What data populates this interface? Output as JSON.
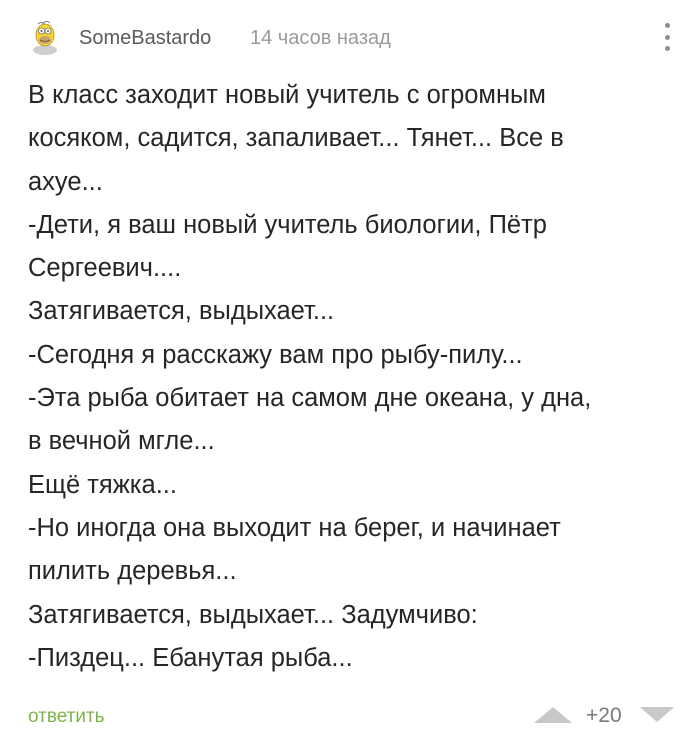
{
  "comment": {
    "author": "SomeBastardo",
    "timestamp": "14 часов назад",
    "lines": [
      "В класс заходит новый учитель с огромным",
      "косяком, садится, запаливает... Тянет... Все в",
      "ахуе...",
      "-Дети, я ваш новый учитель биологии, Пётр",
      "Сергеевич....",
      "Затягивается, выдыхает...",
      "-Сегодня я расскажу вам про рыбу-пилу...",
      "-Эта рыба обитает на самом дне океана, у дна,",
      "в вечной мгле...",
      "Ещё тяжка...",
      "-Но иногда она выходит на берег, и начинает",
      "пилить деревья...",
      "Затягивается, выдыхает... Задумчиво:",
      "-Пиздец... Ебанутая рыба..."
    ]
  },
  "actions": {
    "reply_label": "ответить",
    "score": "+20"
  },
  "icons": {
    "avatar": "homer-simpson-avatar",
    "more": "more-vertical-icon",
    "up": "triangle-up-icon",
    "down": "triangle-down-icon"
  },
  "colors": {
    "reply": "#7fb34d",
    "vote": "#c8c8c8"
  }
}
